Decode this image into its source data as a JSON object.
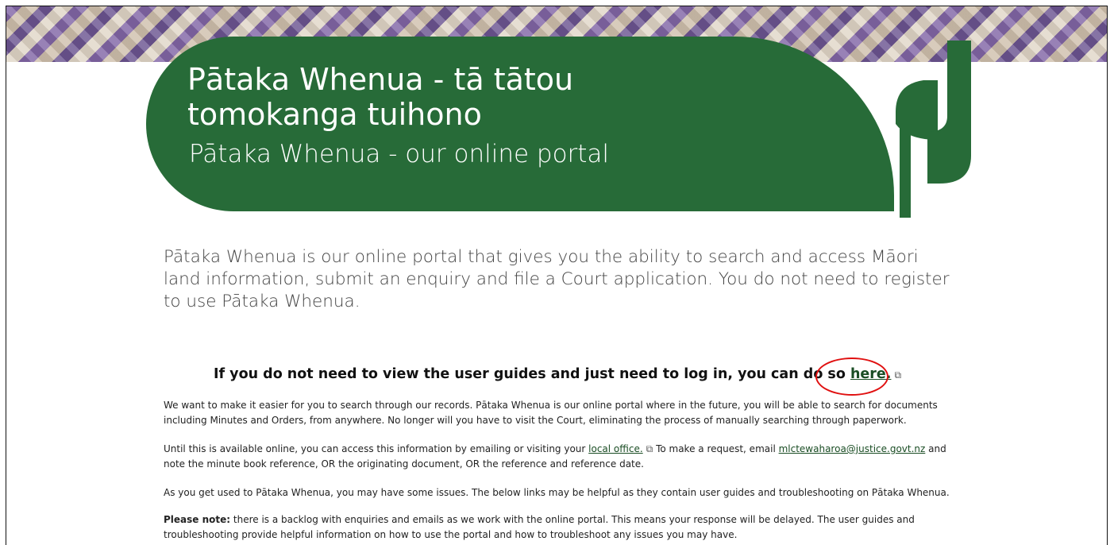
{
  "banner": {
    "title": "Pātaka Whenua - tā tātou tomokanga tuihono",
    "subtitle": "Pātaka Whenua - our online portal"
  },
  "intro": "Pātaka Whenua is our online portal that gives you the ability to search and access Māori land information, submit an enquiry and file a Court application. You do not need to register to use Pātaka Whenua.",
  "login": {
    "text": "If you do not need to view the user guides and just need to log in, you can do so ",
    "link_label": "here."
  },
  "paragraphs": {
    "p1": "We want to make it easier for you to search through our records. Pātaka Whenua is our online portal where in the future, you will be able to search for documents including Minutes and Orders, from anywhere. No longer will you have to visit the Court, eliminating the process of manually searching through paperwork.",
    "p2_before": "Until this is available online, you can access this information by emailing or visiting your ",
    "p2_link": "local office.",
    "p2_middle": " To make a request, email ",
    "p2_email": "mlctewaharoa@justice.govt.nz",
    "p2_after": " and note the minute book reference, OR the originating document, OR the reference and reference date.",
    "p3": "As you get used to Pātaka Whenua, you may have some issues. The below links may be helpful as they contain user guides and troubleshooting on Pātaka Whenua.",
    "p4_bold": "Please note:",
    "p4_rest": " there is a backlog with enquiries and emails as we work with the online portal. This means your response will be delayed. The user guides and troubleshooting provide helpful information on how to use the portal and how to troubleshoot any issues you may have."
  },
  "colors": {
    "brand_green": "#276b38",
    "highlight_circle": "#e01010"
  },
  "icons": {
    "external_link": "external-link-icon",
    "logo": "pataka-whenua-logo"
  }
}
